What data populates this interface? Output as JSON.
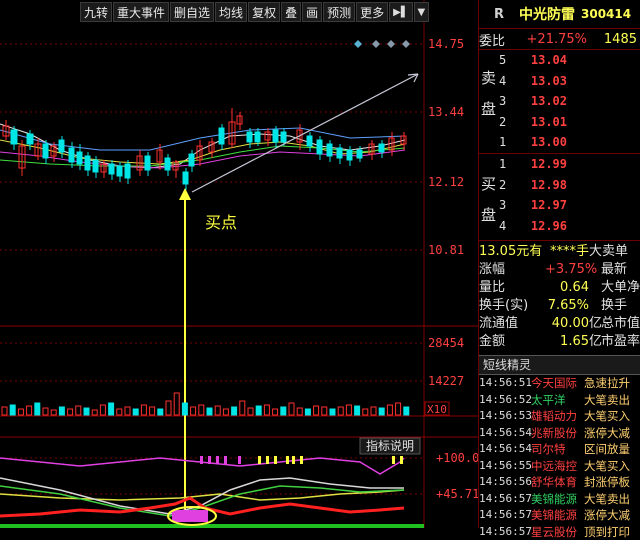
{
  "toolbar": {
    "buttons": [
      "九转",
      "重大事件",
      "删自选",
      "均线",
      "复权",
      "叠",
      "画",
      "预测",
      "更多"
    ],
    "extra_icons": [
      "play-to-end-icon",
      "dropdown-icon"
    ]
  },
  "chart": {
    "price_labels": [
      "14.75",
      "13.44",
      "12.12",
      "10.81"
    ],
    "volume_labels": [
      "28454",
      "14227"
    ],
    "volume_unit": "X10",
    "indicator_button": "指标说明",
    "indicator_labels": [
      "+100.0",
      "+45.71"
    ],
    "annotation": "买点",
    "colors": {
      "up": "#ff3030",
      "down": "#00e5e5",
      "annotation": "#ffff40",
      "grid": "#7a0000"
    }
  },
  "stock": {
    "market": "R",
    "name": "中光防雷",
    "code": "300414",
    "weibi_label": "委比",
    "weibi_value": "+21.75%",
    "weicha_value": "1485",
    "sell_label": [
      "卖",
      "盘"
    ],
    "buy_label": [
      "买",
      "盘"
    ],
    "asks": [
      {
        "level": "5",
        "price": "13.04"
      },
      {
        "level": "4",
        "price": "13.03"
      },
      {
        "level": "3",
        "price": "13.02"
      },
      {
        "level": "2",
        "price": "13.01"
      },
      {
        "level": "1",
        "price": "13.00"
      }
    ],
    "bids": [
      {
        "level": "1",
        "price": "12.99"
      },
      {
        "level": "2",
        "price": "12.98"
      },
      {
        "level": "3",
        "price": "12.97"
      },
      {
        "level": "4",
        "price": "12.96"
      }
    ],
    "stats": [
      {
        "label": "13.05元有",
        "value": "****手",
        "unit": "",
        "label2": "大卖单"
      },
      {
        "label": "涨幅",
        "value": "+3.75%",
        "unit": "",
        "label2": "最新"
      },
      {
        "label": "量比",
        "value": "0.64",
        "unit": "",
        "label2": "大单净"
      },
      {
        "label": "换手(实)",
        "value": "7.65%",
        "unit": "",
        "label2": "换手"
      },
      {
        "label": "流通值",
        "value": "40.00",
        "unit": "亿",
        "label2": "总市值"
      },
      {
        "label": "金额",
        "value": "1.65",
        "unit": "亿",
        "label2": "市盈率"
      }
    ]
  },
  "shortline": {
    "title": "短线精灵",
    "rows": [
      {
        "time": "14:56:51",
        "name": "今天国际",
        "event": "急速拉升",
        "name_color": "red"
      },
      {
        "time": "14:56:52",
        "name": "太平洋",
        "event": "大笔卖出",
        "name_color": "grn"
      },
      {
        "time": "14:56:53",
        "name": "雄韬动力",
        "event": "大笔买入",
        "name_color": "red"
      },
      {
        "time": "14:56:54",
        "name": "兆新股份",
        "event": "涨停大减",
        "name_color": "red"
      },
      {
        "time": "14:56:54",
        "name": "司尔特",
        "event": "区间放量",
        "name_color": "red"
      },
      {
        "time": "14:56:55",
        "name": "中远海控",
        "event": "大笔买入",
        "name_color": "red"
      },
      {
        "time": "14:56:56",
        "name": "舒华体育",
        "event": "封涨停板",
        "name_color": "red"
      },
      {
        "time": "14:56:57",
        "name": "美锦能源",
        "event": "大笔卖出",
        "name_color": "grn"
      },
      {
        "time": "14:56:57",
        "name": "美锦能源",
        "event": "涨停大减",
        "name_color": "red"
      },
      {
        "time": "14:56:57",
        "name": "星云股份",
        "event": "顶到打印",
        "name_color": "red"
      }
    ]
  }
}
